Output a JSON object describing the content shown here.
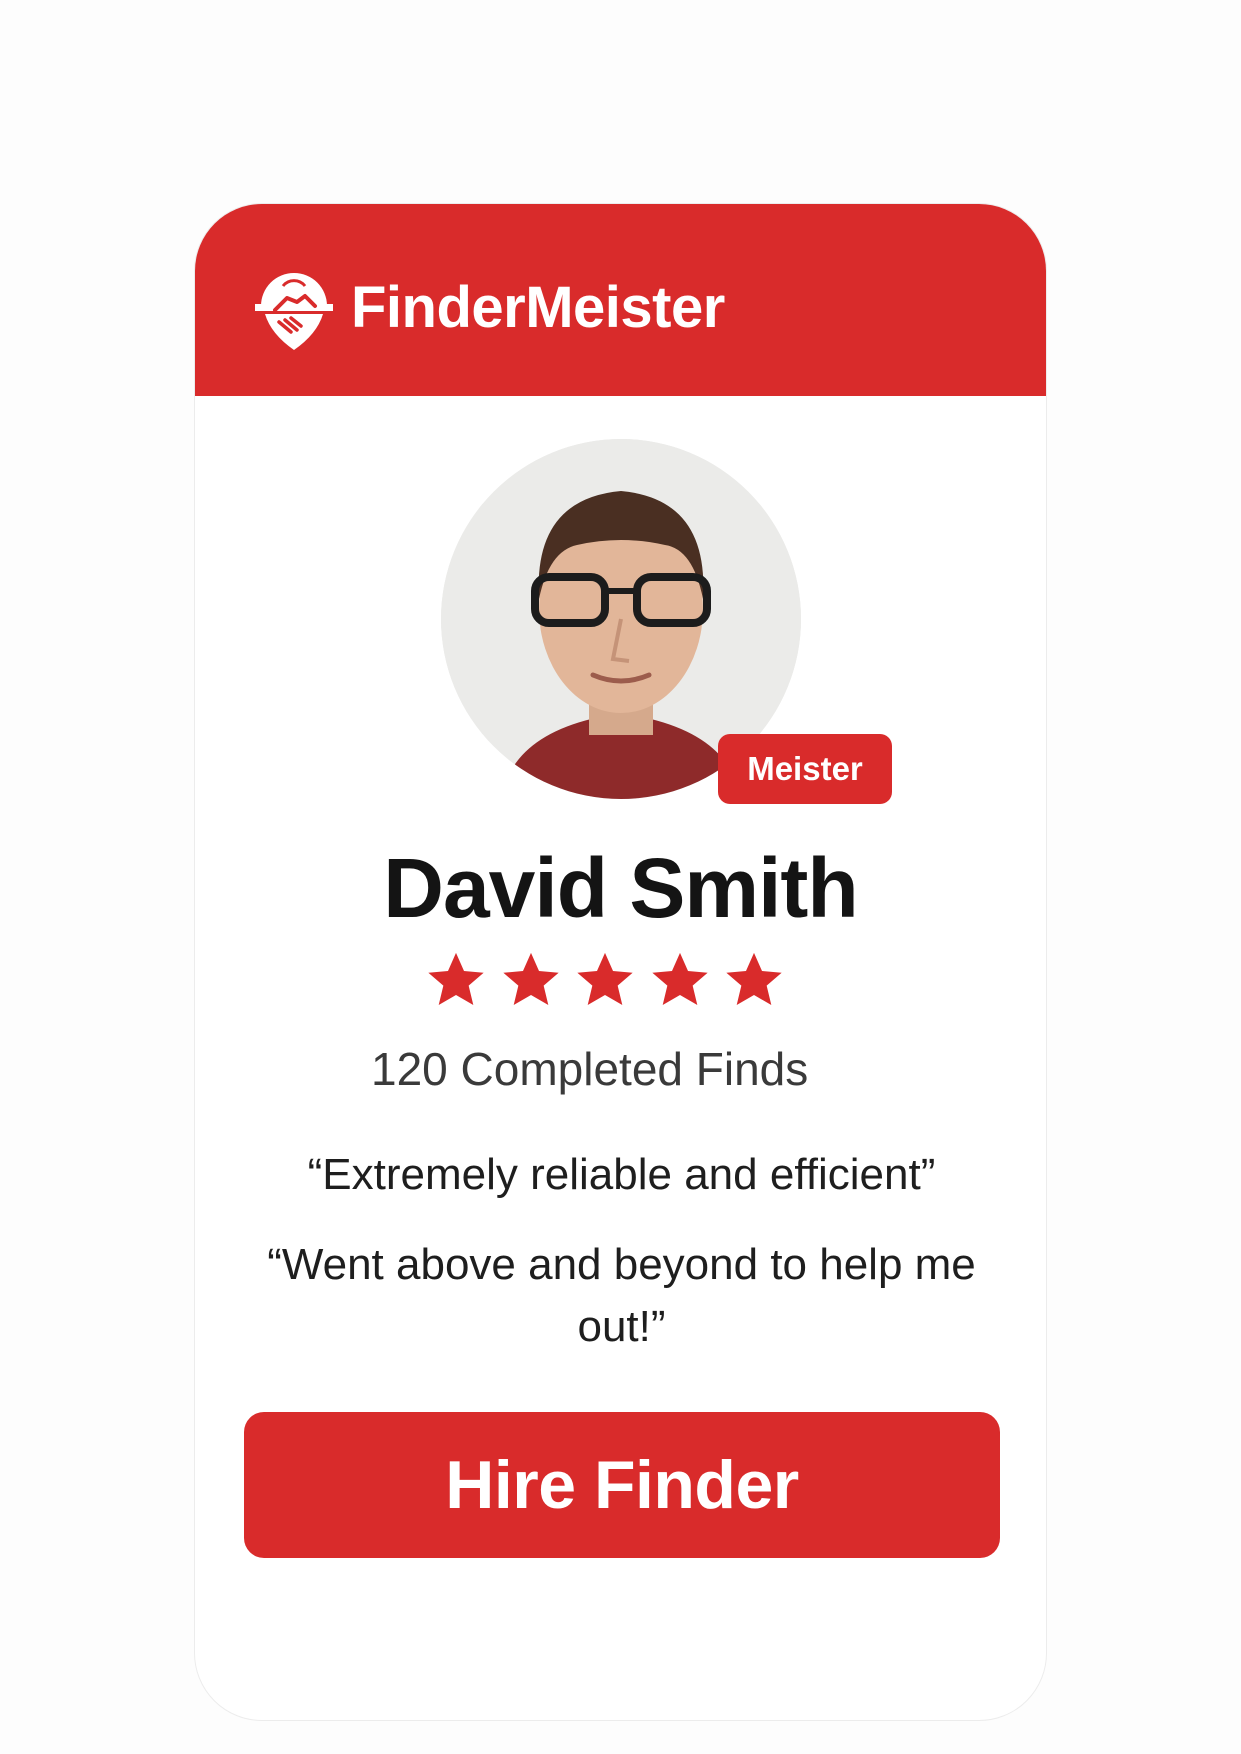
{
  "brand": {
    "name": "FinderMeister",
    "logo_icon": "handshake-shield-icon"
  },
  "profile": {
    "name": "David Smith",
    "badge": "Meister",
    "rating": 5,
    "rating_max": 5,
    "completed_finds": "120 Completed Finds",
    "avatar": "profile-photo"
  },
  "reviews": [
    "“Extremely reliable and efficient”",
    "“Went above and beyond to help me out!”"
  ],
  "actions": {
    "hire_label": "Hire Finder"
  },
  "colors": {
    "accent": "#d92b2b",
    "text": "#141414",
    "background": "#ffffff"
  }
}
